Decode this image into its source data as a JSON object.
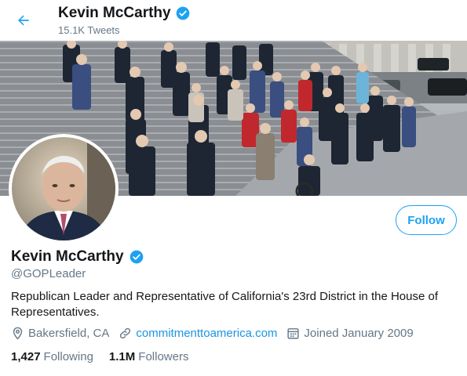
{
  "header": {
    "name": "Kevin McCarthy",
    "tweet_count": "15.1K Tweets"
  },
  "profile": {
    "name": "Kevin McCarthy",
    "handle": "@GOPLeader",
    "bio": "Republican Leader and Representative of California's 23rd District in the House of Representatives.",
    "follow_label": "Follow",
    "location": "Bakersfield, CA",
    "website": "commitmenttoamerica.com",
    "joined": "Joined January 2009",
    "following_count": "1,427",
    "following_label": "Following",
    "followers_count": "1.1M",
    "followers_label": "Followers"
  },
  "colors": {
    "accent": "#1da1f2",
    "verified": "#1da1f2",
    "secondary_text": "#657786"
  }
}
